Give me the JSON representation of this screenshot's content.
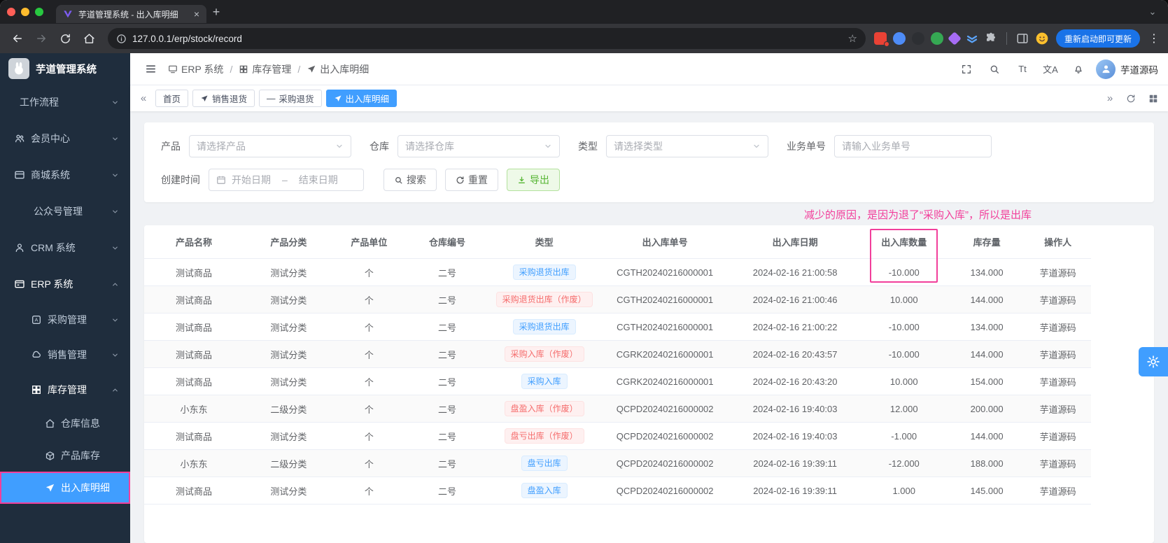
{
  "colors": {
    "accent": "#409eff",
    "highlight": "#f23f9b",
    "danger": "#f56c6c",
    "success": "#55b532"
  },
  "browser": {
    "tab_title": "芋道管理系统 - 出入库明细",
    "url": "127.0.0.1/erp/stock/record",
    "update_button": "重新启动即可更新"
  },
  "icons": {
    "new_tab": "+",
    "close_tab": "×",
    "tab_search": "⌄",
    "menu_dots": "⋮",
    "star": "☆",
    "chevron_left": "«",
    "chevron_right": "»",
    "font_size": "Tt",
    "translate": "文A",
    "minus": "—",
    "date_sep": "–"
  },
  "sidebar": {
    "logo_title": "芋道管理系统",
    "items": [
      {
        "label": "工作流程"
      },
      {
        "label": "会员中心"
      },
      {
        "label": "商城系统"
      },
      {
        "label": "公众号管理"
      },
      {
        "label": "CRM 系统"
      },
      {
        "label": "ERP 系统"
      },
      {
        "label": "采购管理"
      },
      {
        "label": "销售管理"
      },
      {
        "label": "库存管理"
      },
      {
        "label": "仓库信息"
      },
      {
        "label": "产品库存"
      },
      {
        "label": "出入库明细"
      }
    ]
  },
  "header": {
    "breadcrumb": [
      "ERP 系统",
      "库存管理",
      "出入库明细"
    ],
    "username": "芋道源码"
  },
  "tabs": [
    "首页",
    "销售退货",
    "采购退货",
    "出入库明细"
  ],
  "filters": {
    "product_label": "产品",
    "product_placeholder": "请选择产品",
    "warehouse_label": "仓库",
    "warehouse_placeholder": "请选择仓库",
    "type_label": "类型",
    "type_placeholder": "请选择类型",
    "bizno_label": "业务单号",
    "bizno_placeholder": "请输入业务单号",
    "created_label": "创建时间",
    "date_start": "开始日期",
    "date_end": "结束日期",
    "search": "搜索",
    "reset": "重置",
    "export": "导出"
  },
  "annotation": "减少的原因，是因为退了“采购入库”，所以是出库",
  "table": {
    "headers": [
      "产品名称",
      "产品分类",
      "产品单位",
      "仓库编号",
      "类型",
      "出入库单号",
      "出入库日期",
      "出入库数量",
      "库存量",
      "操作人"
    ],
    "rows": [
      {
        "product": "测试商品",
        "category": "测试分类",
        "unit": "个",
        "warehouse": "二号",
        "type": "采购退货出库",
        "type_color": "blue",
        "order_no": "CGTH20240216000001",
        "date": "2024-02-16 21:00:58",
        "quantity": "-10.000",
        "stock": "134.000",
        "operator": "芋道源码"
      },
      {
        "product": "测试商品",
        "category": "测试分类",
        "unit": "个",
        "warehouse": "二号",
        "type": "采购退货出库（作废）",
        "type_color": "red",
        "order_no": "CGTH20240216000001",
        "date": "2024-02-16 21:00:46",
        "quantity": "10.000",
        "stock": "144.000",
        "operator": "芋道源码"
      },
      {
        "product": "测试商品",
        "category": "测试分类",
        "unit": "个",
        "warehouse": "二号",
        "type": "采购退货出库",
        "type_color": "blue",
        "order_no": "CGTH20240216000001",
        "date": "2024-02-16 21:00:22",
        "quantity": "-10.000",
        "stock": "134.000",
        "operator": "芋道源码"
      },
      {
        "product": "测试商品",
        "category": "测试分类",
        "unit": "个",
        "warehouse": "二号",
        "type": "采购入库（作废）",
        "type_color": "red",
        "order_no": "CGRK20240216000001",
        "date": "2024-02-16 20:43:57",
        "quantity": "-10.000",
        "stock": "144.000",
        "operator": "芋道源码"
      },
      {
        "product": "测试商品",
        "category": "测试分类",
        "unit": "个",
        "warehouse": "二号",
        "type": "采购入库",
        "type_color": "blue",
        "order_no": "CGRK20240216000001",
        "date": "2024-02-16 20:43:20",
        "quantity": "10.000",
        "stock": "154.000",
        "operator": "芋道源码"
      },
      {
        "product": "小东东",
        "category": "二级分类",
        "unit": "个",
        "warehouse": "二号",
        "type": "盘盈入库（作废）",
        "type_color": "red",
        "order_no": "QCPD20240216000002",
        "date": "2024-02-16 19:40:03",
        "quantity": "12.000",
        "stock": "200.000",
        "operator": "芋道源码"
      },
      {
        "product": "测试商品",
        "category": "测试分类",
        "unit": "个",
        "warehouse": "二号",
        "type": "盘亏出库（作废）",
        "type_color": "red",
        "order_no": "QCPD20240216000002",
        "date": "2024-02-16 19:40:03",
        "quantity": "-1.000",
        "stock": "144.000",
        "operator": "芋道源码"
      },
      {
        "product": "小东东",
        "category": "二级分类",
        "unit": "个",
        "warehouse": "二号",
        "type": "盘亏出库",
        "type_color": "blue",
        "order_no": "QCPD20240216000002",
        "date": "2024-02-16 19:39:11",
        "quantity": "-12.000",
        "stock": "188.000",
        "operator": "芋道源码"
      },
      {
        "product": "测试商品",
        "category": "测试分类",
        "unit": "个",
        "warehouse": "二号",
        "type": "盘盈入库",
        "type_color": "blue",
        "order_no": "QCPD20240216000002",
        "date": "2024-02-16 19:39:11",
        "quantity": "1.000",
        "stock": "145.000",
        "operator": "芋道源码"
      }
    ]
  }
}
